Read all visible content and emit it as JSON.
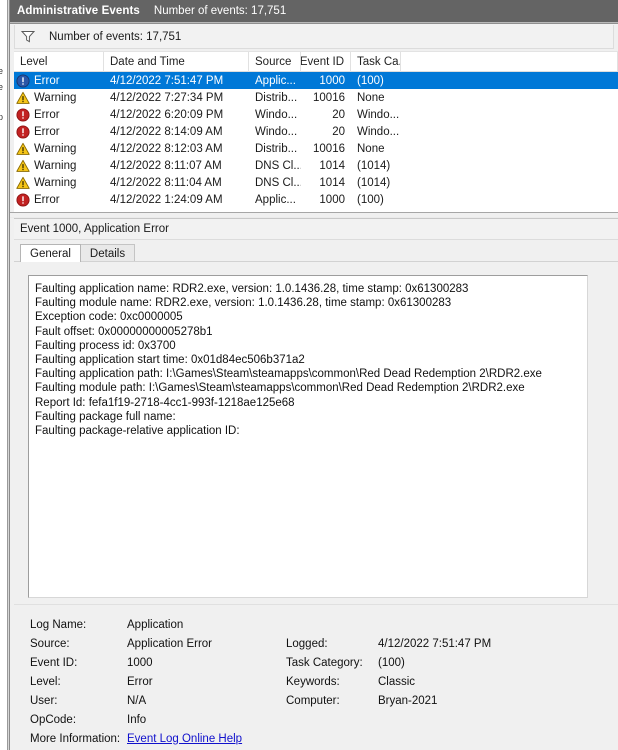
{
  "window": {
    "title": "Administrative Events",
    "subtitle": "Number of events: 17,751"
  },
  "filter_bar": {
    "icon": "filter-funnel-icon",
    "text": "Number of events: 17,751"
  },
  "events_list": {
    "columns": [
      "Level",
      "Date and Time",
      "Source",
      "Event ID",
      "Task Ca..."
    ],
    "rows": [
      {
        "icon": "error-icon",
        "level": "Error",
        "datetime": "4/12/2022 7:51:47 PM",
        "source": "Applic...",
        "event_id": "1000",
        "task_category": "(100)",
        "selected": true
      },
      {
        "icon": "warning-icon",
        "level": "Warning",
        "datetime": "4/12/2022 7:27:34 PM",
        "source": "Distrib...",
        "event_id": "10016",
        "task_category": "None",
        "selected": false
      },
      {
        "icon": "error-icon",
        "level": "Error",
        "datetime": "4/12/2022 6:20:09 PM",
        "source": "Windo...",
        "event_id": "20",
        "task_category": "Windo...",
        "selected": false
      },
      {
        "icon": "error-icon",
        "level": "Error",
        "datetime": "4/12/2022 8:14:09 AM",
        "source": "Windo...",
        "event_id": "20",
        "task_category": "Windo...",
        "selected": false
      },
      {
        "icon": "warning-icon",
        "level": "Warning",
        "datetime": "4/12/2022 8:12:03 AM",
        "source": "Distrib...",
        "event_id": "10016",
        "task_category": "None",
        "selected": false
      },
      {
        "icon": "warning-icon",
        "level": "Warning",
        "datetime": "4/12/2022 8:11:07 AM",
        "source": "DNS Cl...",
        "event_id": "1014",
        "task_category": "(1014)",
        "selected": false
      },
      {
        "icon": "warning-icon",
        "level": "Warning",
        "datetime": "4/12/2022 8:11:04 AM",
        "source": "DNS Cl...",
        "event_id": "1014",
        "task_category": "(1014)",
        "selected": false
      },
      {
        "icon": "error-icon",
        "level": "Error",
        "datetime": "4/12/2022 1:24:09 AM",
        "source": "Applic...",
        "event_id": "1000",
        "task_category": "(100)",
        "selected": false
      }
    ]
  },
  "detail": {
    "header": "Event 1000, Application Error",
    "tabs": [
      {
        "label": "General",
        "active": true
      },
      {
        "label": "Details",
        "active": false
      }
    ],
    "body_lines": [
      "Faulting application name: RDR2.exe, version: 1.0.1436.28, time stamp: 0x61300283",
      "Faulting module name: RDR2.exe, version: 1.0.1436.28, time stamp: 0x61300283",
      "Exception code: 0xc0000005",
      "Fault offset: 0x00000000005278b1",
      "Faulting process id: 0x3700",
      "Faulting application start time: 0x01d84ec506b371a2",
      "Faulting application path: I:\\Games\\Steam\\steamapps\\common\\Red Dead Redemption 2\\RDR2.exe",
      "Faulting module path: I:\\Games\\Steam\\steamapps\\common\\Red Dead Redemption 2\\RDR2.exe",
      "Report Id: fefa1f19-2718-4cc1-993f-1218ae125e68",
      "Faulting package full name:",
      "Faulting package-relative application ID:"
    ]
  },
  "properties": {
    "left": [
      {
        "label": "Log Name:",
        "value": "Application"
      },
      {
        "label": "Source:",
        "value": "Application Error"
      },
      {
        "label": "Event ID:",
        "value": "1000"
      },
      {
        "label": "Level:",
        "value": "Error"
      },
      {
        "label": "User:",
        "value": "N/A"
      },
      {
        "label": "OpCode:",
        "value": "Info"
      },
      {
        "label": "More Information:",
        "value": "Event Log Online Help"
      }
    ],
    "right": [
      {
        "label": "Logged:",
        "value": "4/12/2022 7:51:47 PM"
      },
      {
        "label": "Task Category:",
        "value": "(100)"
      },
      {
        "label": "Keywords:",
        "value": "Classic"
      },
      {
        "label": "Computer:",
        "value": "Bryan-2021"
      }
    ]
  },
  "left_sliver_fragments": [
    "e",
    "e",
    "p"
  ],
  "colors": {
    "titlebar_bg": "#646464",
    "selection_blue": "#0078d7",
    "error_red": "#c22121",
    "warning_yellow": "#f5c518",
    "link_blue": "#1111cc",
    "pane_bg": "#f0f0f0"
  }
}
